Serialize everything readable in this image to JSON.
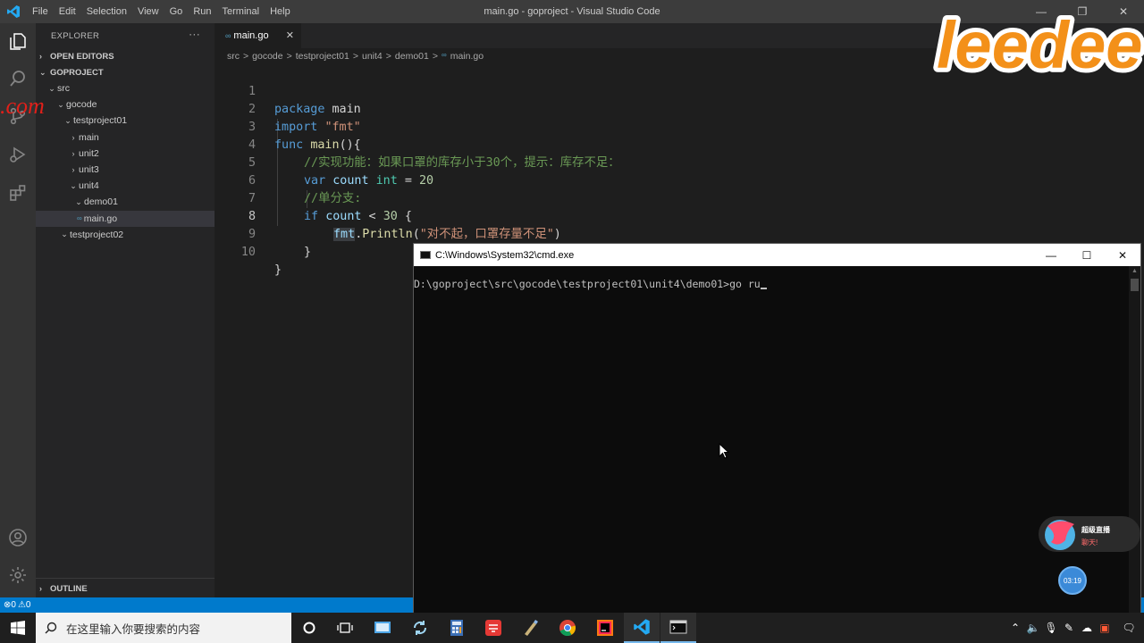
{
  "window": {
    "title": "main.go - goproject - Visual Studio Code",
    "menu": [
      "File",
      "Edit",
      "Selection",
      "View",
      "Go",
      "Run",
      "Terminal",
      "Help"
    ]
  },
  "sidebar": {
    "header": "EXPLORER",
    "more": "···",
    "open_editors": "OPEN EDITORS",
    "project": "GOPROJECT",
    "tree": {
      "src": "src",
      "gocode": "gocode",
      "testproject01": "testproject01",
      "main": "main",
      "unit2": "unit2",
      "unit3": "unit3",
      "unit4": "unit4",
      "demo01": "demo01",
      "main_go": "main.go",
      "testproject02": "testproject02"
    },
    "outline": "OUTLINE"
  },
  "editor": {
    "tab": "main.go",
    "breadcrumb": [
      "src",
      ">",
      "gocode",
      ">",
      "testproject01",
      ">",
      "unit4",
      ">",
      "demo01",
      ">",
      "main.go"
    ],
    "line_numbers": [
      "1",
      "2",
      "3",
      "4",
      "5",
      "6",
      "7",
      "8",
      "9",
      "10"
    ],
    "code": {
      "l1_kw": "package",
      "l1_rest": " main",
      "l2_kw": "import",
      "l2_str": "\"fmt\"",
      "l3_kw": "func",
      "l3_fn": "main",
      "l3_rest": "(){",
      "l4_comment": "//实现功能：如果口罩的库存小于30个，提示：库存不足：",
      "l5_kw": "var",
      "l5_var": "count",
      "l5_type": "int",
      "l5_eq": " = ",
      "l5_num": "20",
      "l6_comment": "//单分支:",
      "l7_kw": "if",
      "l7_var": "count",
      "l7_op": " < ",
      "l7_num": "30",
      "l7_brace": " {",
      "l8_pkg": "fmt",
      "l8_dot": ".",
      "l8_fn": "Println",
      "l8_open": "(",
      "l8_str": "\"对不起，口罩存量不足\"",
      "l8_close": ")",
      "l9": "}",
      "l10": "}"
    }
  },
  "status": {
    "errors": "0",
    "warnings": "0"
  },
  "cmd": {
    "title": "C:\\Windows\\System32\\cmd.exe",
    "prompt": "D:\\goproject\\src\\gocode\\testproject01\\unit4\\demo01>",
    "typed": "go ru"
  },
  "logo": {
    "text": "leedee"
  },
  "watermark": {
    "text": ".com"
  },
  "live": {
    "line1": "超级直播",
    "line2": "聊天!",
    "timer": "03:19"
  },
  "taskbar": {
    "search_placeholder": "在这里输入你要搜索的内容"
  },
  "colors": {
    "accent": "#007acc",
    "editor_bg": "#1e1e1e",
    "sidebar_bg": "#252526",
    "keyword": "#569cd6",
    "string": "#ce9178",
    "comment": "#6a9955",
    "logo_orange": "#f39019"
  }
}
